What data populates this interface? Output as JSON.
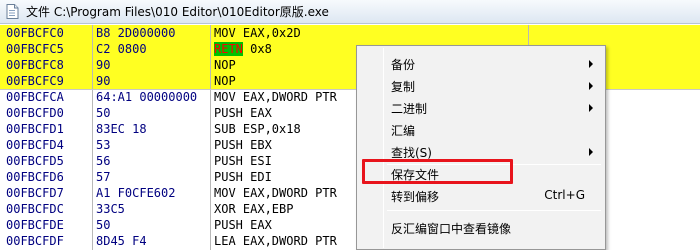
{
  "window": {
    "title": "文件 C:\\Program Files\\010 Editor\\010Editor原版.exe",
    "icon": "document-icon"
  },
  "disassembly": {
    "rows": [
      {
        "addr": "00FBCFC0",
        "hex": "B8 2D000000",
        "instr": "MOV EAX,0x2D",
        "selected": true
      },
      {
        "addr": "00FBCFC5",
        "hex": "C2 0800",
        "instr": "RETN 0x8",
        "selected": true,
        "mnem": "RETN",
        "operands": " 0x8"
      },
      {
        "addr": "00FBCFC8",
        "hex": "90",
        "instr": "NOP",
        "selected": true
      },
      {
        "addr": "00FBCFC9",
        "hex": "90",
        "instr": "NOP",
        "selected": true
      },
      {
        "addr": "00FBCFCA",
        "hex": "64:A1 00000000",
        "instr": "MOV EAX,DWORD PTR",
        "selected": false
      },
      {
        "addr": "00FBCFD0",
        "hex": "50",
        "instr": "PUSH EAX",
        "selected": false
      },
      {
        "addr": "00FBCFD1",
        "hex": "83EC 18",
        "instr": "SUB ESP,0x18",
        "selected": false
      },
      {
        "addr": "00FBCFD4",
        "hex": "53",
        "instr": "PUSH EBX",
        "selected": false
      },
      {
        "addr": "00FBCFD5",
        "hex": "56",
        "instr": "PUSH ESI",
        "selected": false
      },
      {
        "addr": "00FBCFD6",
        "hex": "57",
        "instr": "PUSH EDI",
        "selected": false
      },
      {
        "addr": "00FBCFD7",
        "hex": "A1 F0CFE602",
        "instr": "MOV EAX,DWORD PTR",
        "selected": false
      },
      {
        "addr": "00FBCFDC",
        "hex": "33C5",
        "instr": "XOR EAX,EBP",
        "selected": false
      },
      {
        "addr": "00FBCFDE",
        "hex": "50",
        "instr": "PUSH EAX",
        "selected": false
      },
      {
        "addr": "00FBCFDF",
        "hex": "8D45 F4",
        "instr": "LEA EAX,DWORD PTR",
        "selected": false
      }
    ],
    "colors": {
      "selection": "#ffff22",
      "address": "#000080",
      "retn_bg": "#00c000",
      "retn_fg": "#ff0000"
    }
  },
  "context_menu": {
    "items": [
      {
        "label": "备份",
        "submenu": true
      },
      {
        "label": "复制",
        "submenu": true
      },
      {
        "label": "二进制",
        "submenu": true
      },
      {
        "label": "汇编",
        "submenu": false
      },
      {
        "label": "查找(S)",
        "submenu": true
      },
      {
        "label": "保存文件",
        "submenu": false,
        "highlighted": true
      },
      {
        "label": "转到偏移",
        "shortcut": "Ctrl+G"
      },
      {
        "label": "反汇编窗口中查看镜像",
        "submenu": false
      }
    ],
    "highlight_color": "#e8141c"
  }
}
